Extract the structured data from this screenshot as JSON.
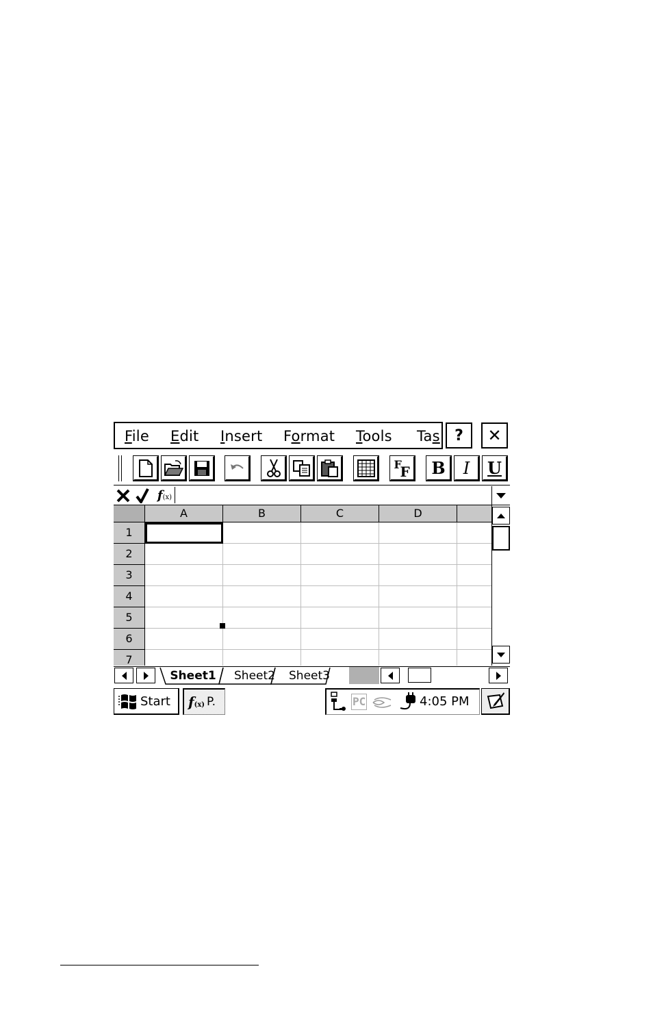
{
  "menu": {
    "items": [
      {
        "pre": "",
        "key": "F",
        "post": "ile"
      },
      {
        "pre": "",
        "key": "E",
        "post": "dit"
      },
      {
        "pre": "",
        "key": "I",
        "post": "nsert"
      },
      {
        "pre": "F",
        "key": "o",
        "post": "rmat"
      },
      {
        "pre": "",
        "key": "T",
        "post": "ools"
      },
      {
        "pre": "Ta",
        "key": "s",
        "post": ""
      }
    ],
    "help_label": "?",
    "close_label": "✕"
  },
  "toolbar": {
    "bold_label": "B",
    "italic_label": "I",
    "underline_label": "U",
    "font_label_big": "F",
    "font_label_small": "F",
    "icons": [
      "new-document-icon",
      "open-folder-icon",
      "save-icon",
      "undo-icon",
      "cut-icon",
      "copy-icon",
      "paste-icon",
      "table-icon",
      "font-icon"
    ]
  },
  "formula_bar": {
    "cancel_label": "✕",
    "enter_label": "✓",
    "fx_label": "f",
    "fx_sub": "(x)",
    "value": ""
  },
  "grid": {
    "columns": [
      "A",
      "B",
      "C",
      "D",
      ""
    ],
    "rows": [
      "1",
      "2",
      "3",
      "4",
      "5",
      "6",
      "7"
    ],
    "active_cell": "A1"
  },
  "sheets": {
    "tabs": [
      "Sheet1",
      "Sheet2",
      "Sheet3"
    ],
    "active": "Sheet1"
  },
  "taskbar": {
    "start_label": "Start",
    "task_label": "P.",
    "tray_pc": "PC",
    "clock": "4:05 PM"
  },
  "colors": {
    "header_gray": "#c8c8c8",
    "gridline": "#bdbdbd",
    "tab_fill": "#b0b0b0"
  }
}
